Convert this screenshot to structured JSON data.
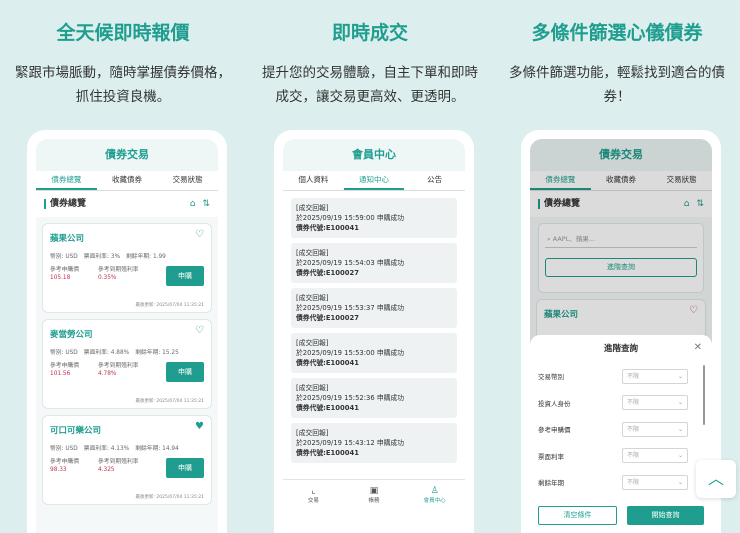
{
  "columns": [
    {
      "title": "全天候即時報價",
      "desc": "緊跟市場脈動，隨時掌握債券價格，抓住投資良機。",
      "phone": {
        "header": "債券交易",
        "tabs": [
          "債券總覽",
          "收藏債券",
          "交易狀態"
        ],
        "section": "債券總覽",
        "cards": [
          {
            "name": "蘋果公司",
            "currency": "幣別: USD",
            "coupon": "票面利率: 3%",
            "remain": "剩餘年期: 1.99",
            "price_label": "參考申購價",
            "price": "105.18",
            "yield_label": "參考到期殖利率",
            "yield": "0.35%",
            "buy": "申購",
            "updated": "最後更新: 2025/07/04 11:35:21",
            "fav": false
          },
          {
            "name": "麥當勞公司",
            "currency": "幣別: USD",
            "coupon": "票面利率: 4.88%",
            "remain": "剩餘年期: 15.25",
            "price_label": "參考申購價",
            "price": "101.56",
            "yield_label": "參考到期殖利率",
            "yield": "4.78%",
            "buy": "申購",
            "updated": "最後更新: 2025/07/04 11:35:21",
            "fav": false
          },
          {
            "name": "可口可樂公司",
            "currency": "幣別: USD",
            "coupon": "票面利率: 4.13%",
            "remain": "剩餘年期: 14.94",
            "price_label": "參考申購價",
            "price": "98.33",
            "yield_label": "參考到期殖利率",
            "yield": "4.325",
            "buy": "申購",
            "updated": "最後更新: 2025/07/04 11:35:21",
            "fav": true
          }
        ]
      }
    },
    {
      "title": "即時成交",
      "desc": "提升您的交易體驗，自主下單和即時成交，讓交易更高效、更透明。",
      "phone": {
        "header": "會員中心",
        "tabs": [
          "個人資料",
          "通知中心",
          "公告"
        ],
        "notices": [
          {
            "h": "[成交回報]",
            "l1": "於2025/09/19 15:59:00 申購成功",
            "l2": "債券代號:E100041"
          },
          {
            "h": "[成交回報]",
            "l1": "於2025/09/19 15:54:03 申購成功",
            "l2": "債券代號:E100027"
          },
          {
            "h": "[成交回報]",
            "l1": "於2025/09/19 15:53:37 申購成功",
            "l2": "債券代號:E100027"
          },
          {
            "h": "[成交回報]",
            "l1": "於2025/09/19 15:53:00 申購成功",
            "l2": "債券代號:E100041"
          },
          {
            "h": "[成交回報]",
            "l1": "於2025/09/19 15:52:36 申購成功",
            "l2": "債券代號:E100041"
          },
          {
            "h": "[成交回報]",
            "l1": "於2025/09/19 15:43:12 申購成功",
            "l2": "債券代號:E100041"
          }
        ],
        "nav": [
          "交易",
          "帳務",
          "會員中心"
        ]
      }
    },
    {
      "title": "多條件篩選心儀債券",
      "desc": "多條件篩選功能，輕鬆找到適合的債券！",
      "phone": {
        "header": "債券交易",
        "tabs": [
          "債券總覽",
          "收藏債券",
          "交易狀態"
        ],
        "section": "債券總覽",
        "search_placeholder": "AAPL、蘋果...",
        "adv_btn": "進階查詢",
        "peek_card": "蘋果公司",
        "modal_title": "進階查詢",
        "filters": [
          {
            "label": "交易幣別",
            "value": "不限"
          },
          {
            "label": "投資人身份",
            "value": "不限"
          },
          {
            "label": "參考申購價",
            "value": "不限"
          },
          {
            "label": "票面利率",
            "value": "不限"
          },
          {
            "label": "剩餘年期",
            "value": "不限"
          }
        ],
        "clear": "清空條件",
        "go": "開始查詢"
      }
    }
  ],
  "top_button": "︿"
}
